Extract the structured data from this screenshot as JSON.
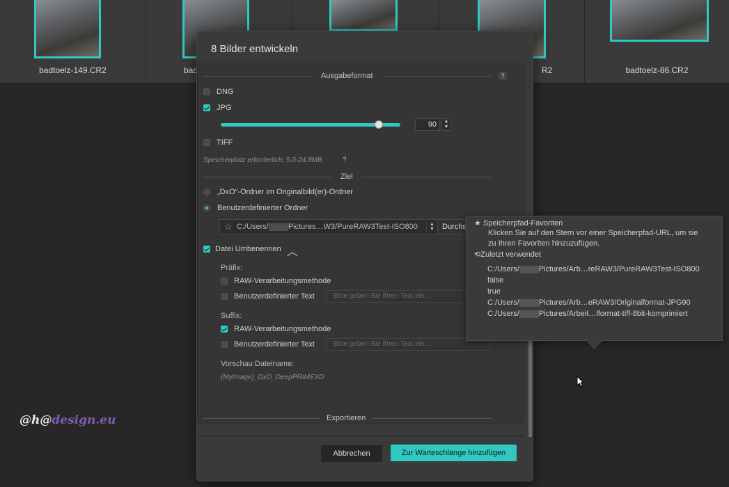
{
  "thumbnails": [
    {
      "label": "badtoelz-149.CR2"
    },
    {
      "label": "badt"
    },
    {
      "label": ""
    },
    {
      "label": "R2"
    },
    {
      "label": "badtoelz-86.CR2"
    }
  ],
  "dialog": {
    "title": "8 Bilder entwickeln",
    "output_format": {
      "heading": "Ausgabeformat",
      "help": "?",
      "dng_label": "DNG",
      "dng_checked": false,
      "jpg_label": "JPG",
      "jpg_checked": true,
      "quality": "90",
      "quality_level": 0.89,
      "tiff_label": "TIFF",
      "tiff_checked": false,
      "storage_note": "Speicherplatz erforderlich: 5.0-24.8MB",
      "storage_help": "?"
    },
    "target": {
      "heading": "Ziel",
      "option_dxo": "„DxO“-Ordner im Originalbild(er)-Ordner",
      "option_custom": "Benutzerdefinierter Ordner",
      "selected": "custom",
      "path_prefix": "C:/Users/",
      "path_suffix": "Pictures…W3/PureRAW3Test-ISO800",
      "browse_label": "Durchsuchen"
    },
    "rename": {
      "label": "Datei Umbenennen",
      "prefix_label": "Präfix:",
      "prefix_raw": "RAW-Verarbeitungsmethode",
      "prefix_raw_checked": false,
      "prefix_custom": "Benutzerdefinierter Text",
      "prefix_custom_checked": false,
      "prefix_placeholder": "Bitte geben Sie Ihren Text ein...",
      "suffix_label": "Suffix:",
      "suffix_raw": "RAW-Verarbeitungsmethode",
      "suffix_raw_checked": true,
      "suffix_custom": "Benutzerdefinierter Text",
      "suffix_custom_checked": false,
      "suffix_placeholder": "Bitte geben Sie Ihren Text ein...",
      "preview_label": "Vorschau Dateiname:",
      "preview_value": "{MyImage}_DxO_DeepPRIMEXD"
    },
    "export": {
      "heading": "Exportieren"
    },
    "cancel_label": "Abbrechen",
    "queue_label": "Zur Warteschlange hinzufügen"
  },
  "tooltip": {
    "favorites_title": "Speicherpfad-Favoriten",
    "favorites_hint_1": "Klicken Sie auf den Stern vor einer Speicherpfad-URL, um sie",
    "favorites_hint_2": "zu Ihren Favoriten hinzuzufügen.",
    "recent_title": "Zuletzt verwendet",
    "recent": [
      {
        "pre": "C:/Users/",
        "post": "Pictures/Arb…reRAW3/PureRAW3Test-ISO800",
        "blur": true
      },
      {
        "pre": "false",
        "post": "",
        "blur": false
      },
      {
        "pre": "true",
        "post": "",
        "blur": false
      },
      {
        "pre": "C:/Users/",
        "post": "Pictures/Arb…eRAW3/Originalformat-JPG90",
        "blur": true
      },
      {
        "pre": "C:/Users/",
        "post": "Pictures/Arbeit…lformat-tiff-8bit-komprimiert",
        "blur": true
      }
    ]
  },
  "watermark": {
    "part1": "@h@",
    "part2": "design.eu"
  },
  "colors": {
    "accent": "#2fc9c2",
    "background": "#272727",
    "dialog": "#3a3a3a"
  },
  "icons": {
    "star": "star-icon",
    "history": "history-icon",
    "collapse": "chevron-up-icon"
  }
}
